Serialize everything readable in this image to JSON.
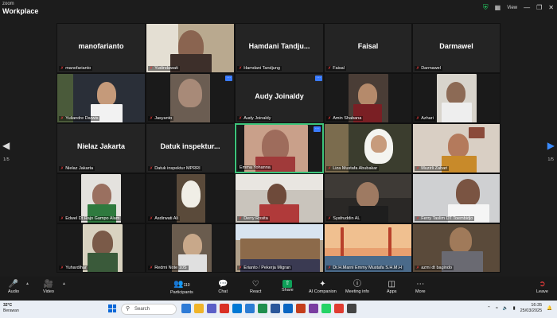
{
  "window": {
    "brand_small": "zoom",
    "brand": "Workplace",
    "view_label": "View"
  },
  "gallery": {
    "page_left": "1/5",
    "page_right": "1/5",
    "tiles": [
      {
        "big_name": "manofarianto",
        "label": "manofarianto"
      },
      {
        "big_name": "",
        "label": "Yudindawati"
      },
      {
        "big_name": "Hamdani  Tandju...",
        "label": "Hamdani Tandjung"
      },
      {
        "big_name": "Faisal",
        "label": "Faisal"
      },
      {
        "big_name": "Darmawel",
        "label": "Darmawel"
      },
      {
        "big_name": "",
        "label": "Yuliandre Darwis"
      },
      {
        "big_name": "",
        "label": "Jasyanto"
      },
      {
        "big_name": "Audy Joinaldy",
        "label": "Audy Joinaldy"
      },
      {
        "big_name": "",
        "label": "Amin Shabana"
      },
      {
        "big_name": "",
        "label": "Azhari"
      },
      {
        "big_name": "Nielaz Jakarta",
        "label": "Nielaz Jakarta"
      },
      {
        "big_name": "Datuk  inspektur...",
        "label": "Datuk inspektur MPRRI"
      },
      {
        "big_name": "",
        "label": "Emma Yohanna"
      },
      {
        "big_name": "",
        "label": "Liza Mustafa Abubakar"
      },
      {
        "big_name": "",
        "label": "Muzirli Zahari"
      },
      {
        "big_name": "",
        "label": "Edwel Dt Rajo Gampo Alam"
      },
      {
        "big_name": "",
        "label": "Asdirwati Ali"
      },
      {
        "big_name": "",
        "label": "Derry Rosita"
      },
      {
        "big_name": "",
        "label": "Syafruddin AL"
      },
      {
        "big_name": "",
        "label": "Ferry Taslim DT Toembidjo"
      },
      {
        "big_name": "",
        "label": "Yuhardihar"
      },
      {
        "big_name": "",
        "label": "Redmi Note 10S"
      },
      {
        "big_name": "",
        "label": "Erianto / Pekerja Migran"
      },
      {
        "big_name": "",
        "label": "Dr.H.Marni Emmy Mustafa S.H.M.H"
      },
      {
        "big_name": "",
        "label": "azmi dt bagindo"
      }
    ]
  },
  "toolbar": {
    "audio": "Audio",
    "video": "Video",
    "participants": "Participants",
    "participants_count": "110",
    "chat": "Chat",
    "react": "React",
    "share": "Share",
    "ai_companion": "AI Companion",
    "meeting_info": "Meeting info",
    "apps": "Apps",
    "more": "More",
    "leave": "Leave"
  },
  "taskbar": {
    "temp": "32°C",
    "weather": "Berawan",
    "search_placeholder": "Search",
    "time": "16:35",
    "date": "25/03/2025"
  },
  "colors": {
    "active_border": "#3cc37a",
    "share_green": "#0e9f58",
    "leave_red": "#e23b3b",
    "mute_red": "#e23b3b"
  }
}
